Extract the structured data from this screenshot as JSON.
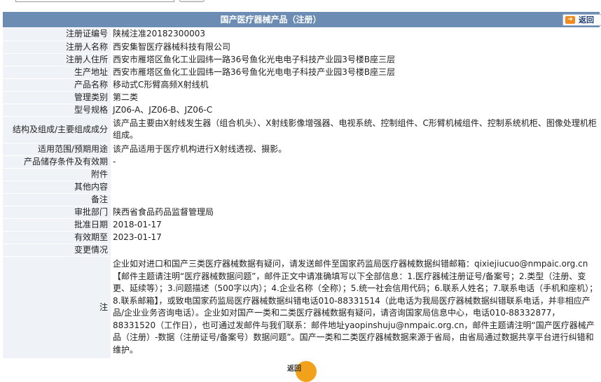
{
  "page": {
    "title": "国产医疗器械产品（注册）",
    "back_label": "返回",
    "back_icon": "arrow-right-icon"
  },
  "rows": [
    {
      "label": "注册证编号",
      "value": "陕械注准20182300003"
    },
    {
      "label": "注册人名称",
      "value": "西安集智医疗器械科技有限公司"
    },
    {
      "label": "注册人住所",
      "value": "西安市雁塔区鱼化工业园纬一路36号鱼化光电电子科技产业园3号楼B座三层"
    },
    {
      "label": "生产地址",
      "value": "西安市雁塔区鱼化工业园纬一路36号鱼化光电电子科技产业园3号楼B座三层"
    },
    {
      "label": "产品名称",
      "value": "移动式C形臂高频X射线机"
    },
    {
      "label": "管理类别",
      "value": "第二类"
    },
    {
      "label": "型号规格",
      "value": "JZ06-A、JZ06-B、JZ06-C"
    },
    {
      "label": "结构及组成/主要组成成分",
      "value": "该产品主要由X射线发生器（组合机头）、X射线影像增强器、电视系统、控制组件、C形臂机械组件、控制系统机柜、图像处理机柜组成。"
    },
    {
      "label": "适用范围/预期用途",
      "value": "该产品适用于医疗机构进行X射线透视、摄影。"
    },
    {
      "label": "产品储存条件及有效期",
      "value": "-"
    },
    {
      "label": "附件",
      "value": ""
    },
    {
      "label": "其他内容",
      "value": ""
    },
    {
      "label": "备注",
      "value": ""
    },
    {
      "label": "审批部门",
      "value": "陕西省食品药品监督管理局"
    },
    {
      "label": "批准日期",
      "value": "2018-01-17"
    },
    {
      "label": "有效期至",
      "value": "2023-01-17"
    },
    {
      "label": "变更情况",
      "value": ""
    }
  ],
  "note": {
    "label": "注",
    "text": "企业如对进口和国产三类医疗器械数据有疑问，请发送邮件至国家药监局医疗器械数据纠错邮箱：qixiejiucuo@nmpaic.org.cn【邮件主题请注明“医疗器械数据问题”，邮件正文中请准确填写以下全部信息：1.医疗器械注册证号/备案号；2.类型（注册、变更、延续等）；3.问题描述（500字以内）；4.企业名称（全称）；5.统一社会信用代码；6.联系人姓名；7.联系电话（手机和座机）；8.联系邮箱】，或致电国家药监局医疗器械数据纠错电话010-88331514（此电话为我局医疗器械数据纠错联系电话，并非相应产品/企业业务咨询电话）。企业如对国产一类和二类医疗器械数据有疑问，请咨询国家局信息中心，电话010-88332877，88331520（工作日），也可通过发邮件与我们联系：邮件地址yaopinshuju@nmpaic.org.cn，邮件主题请注明“国产医疗器械产品（注册）-数据（注册证号/备案号）数据问题”。国产一类和二类医疗器械数据来源于省局，由省局通过数据共享平台进行纠错和维护。"
  },
  "footer": {
    "back_label": "返回"
  }
}
